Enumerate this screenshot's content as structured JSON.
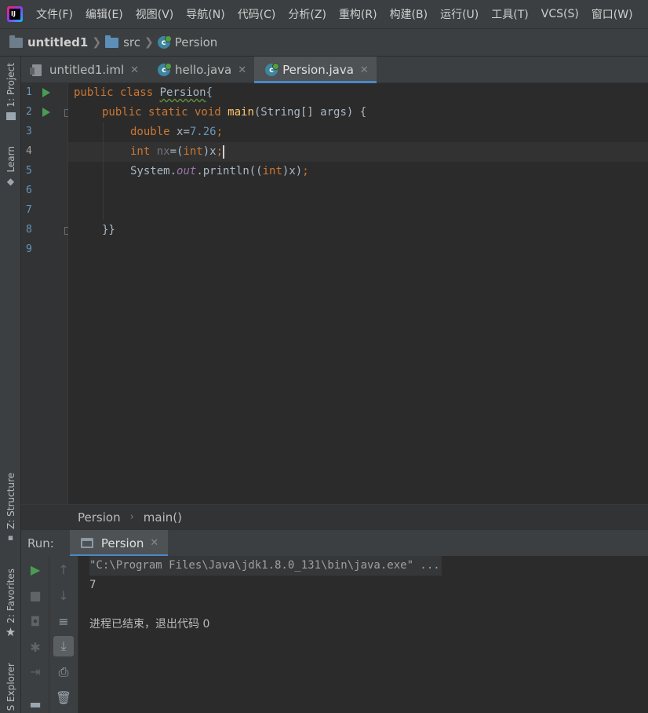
{
  "menu": {
    "items": [
      "文件(F)",
      "编辑(E)",
      "视图(V)",
      "导航(N)",
      "代码(C)",
      "分析(Z)",
      "重构(R)",
      "构建(B)",
      "运行(U)",
      "工具(T)",
      "VCS(S)",
      "窗口(W)"
    ]
  },
  "app_logo_text": "IJ",
  "breadcrumb": {
    "project": "untitled1",
    "folder": "src",
    "file": "Persion"
  },
  "tabs": [
    {
      "label": "untitled1.iml",
      "icon": "iml-file-icon"
    },
    {
      "label": "hello.java",
      "icon": "java-class-icon"
    },
    {
      "label": "Persion.java",
      "icon": "java-class-icon",
      "active": true
    }
  ],
  "left_strip": {
    "project": "1: Project",
    "learn": "Learn",
    "structure": "Z: Structure",
    "favorites": "2: Favorites",
    "explorer": "S Explorer"
  },
  "editor": {
    "line_numbers": [
      "1",
      "2",
      "3",
      "4",
      "5",
      "6",
      "7",
      "8",
      "9"
    ],
    "current_line": 4,
    "code": {
      "l1_kw": "public class ",
      "l1_name": "Persion",
      "l1_brace": "{",
      "l2_kw": "public static void ",
      "l2_fn": "main",
      "l2_rest": "(String[] args) {",
      "l3_kw": "double ",
      "l3_var": "x=",
      "l3_num": "7.26",
      "l3_end": ";",
      "l4_kw": "int ",
      "l4_var": "nx",
      "l4_eq": "=(",
      "l4_cast": "int",
      "l4_rest": ")x",
      "l4_end": ";",
      "l5_sys": "System.",
      "l5_out": "out",
      "l5_call": ".println((",
      "l5_cast": "int",
      "l5_rest": ")x)",
      "l5_end": ";",
      "l8": "}}"
    }
  },
  "editor_crumbs": {
    "class": "Persion",
    "method": "main()"
  },
  "run": {
    "label": "Run:",
    "tab": "Persion",
    "console": {
      "command": "\"C:\\Program Files\\Java\\jdk1.8.0_131\\bin\\java.exe\" ...",
      "output": "7",
      "exit": "进程已结束，退出代码 0"
    }
  },
  "colors": {
    "keyword": "#cc7832",
    "number": "#6897bb",
    "method": "#ffc66d",
    "field": "#9876aa",
    "accent": "#4a88c7",
    "run_green": "#499c54"
  }
}
